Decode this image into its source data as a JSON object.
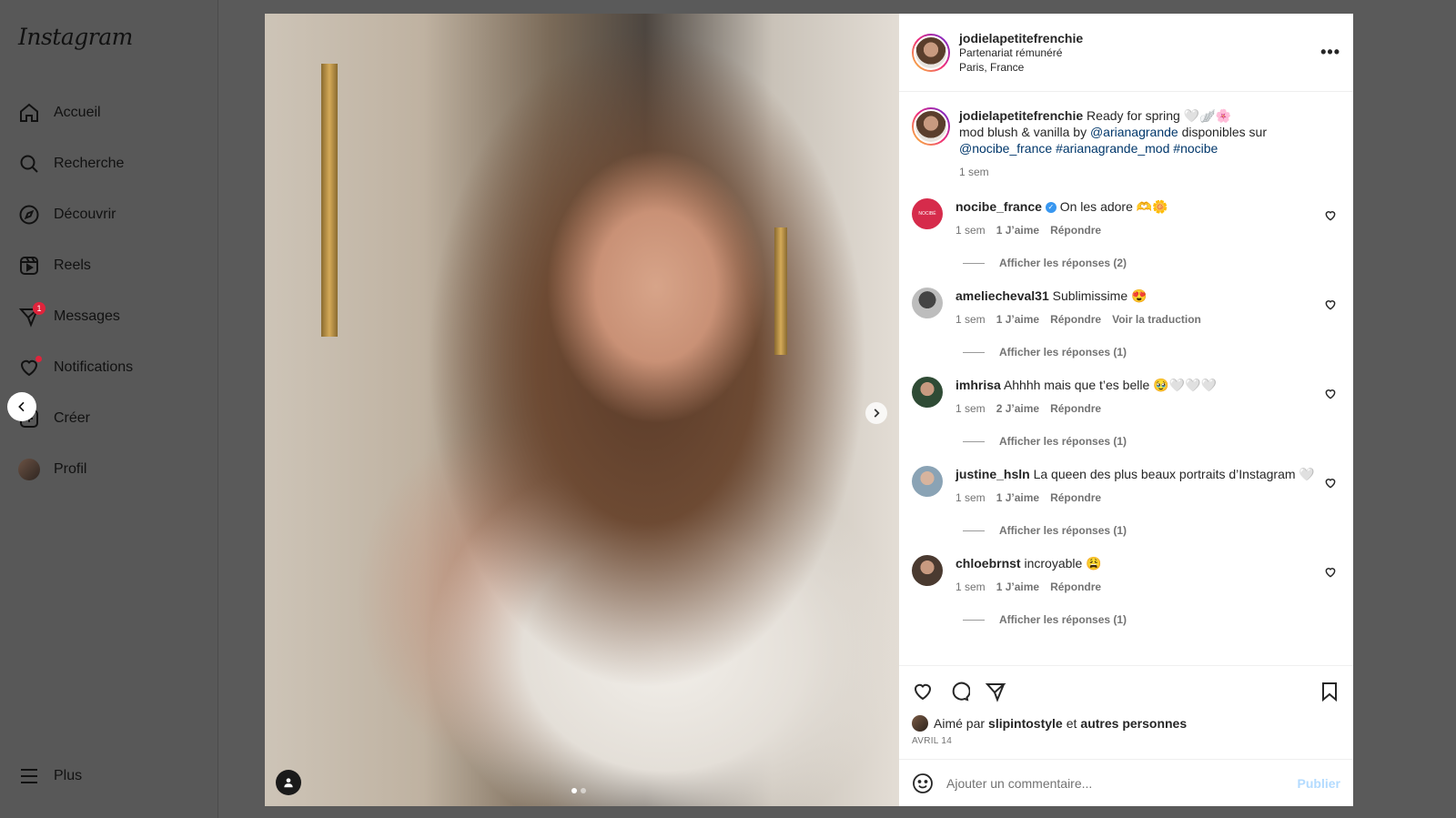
{
  "app": {
    "logo": "Instagram"
  },
  "sidebar": {
    "items": [
      {
        "label": "Accueil",
        "icon": "home-icon"
      },
      {
        "label": "Recherche",
        "icon": "search-icon"
      },
      {
        "label": "Découvrir",
        "icon": "compass-icon"
      },
      {
        "label": "Reels",
        "icon": "reels-icon"
      },
      {
        "label": "Messages",
        "icon": "messenger-icon",
        "badge": "1"
      },
      {
        "label": "Notifications",
        "icon": "heart-icon"
      },
      {
        "label": "Créer",
        "icon": "plus-square-icon"
      },
      {
        "label": "Profil",
        "icon": "avatar"
      }
    ],
    "more_label": "Plus"
  },
  "post": {
    "author": "jodielapetitefrenchie",
    "paid_partnership": "Partenariat rémunéré",
    "location": "Paris, France",
    "caption": {
      "text1": "Ready for spring 🤍🪽🌸",
      "text2": "mod blush & vanilla by ",
      "mention1": "@arianagrande",
      "text3": " disponibles sur",
      "mention2": "@nocibe_france",
      "tag1": "#arianagrande_mod",
      "tag2": "#nocibe",
      "time": "1 sem"
    },
    "carousel": {
      "current": 1,
      "total": 2
    }
  },
  "comments": [
    {
      "user": "nocibe_france",
      "verified": true,
      "text": "On les adore 🫶🌼",
      "time": "1 sem",
      "likes": "1 J’aime",
      "reply": "Répondre",
      "translate": "",
      "replies": "Afficher les réponses (2)",
      "avatar_color": "#d62b4b",
      "avatar_text": "NOCIBÉ"
    },
    {
      "user": "ameliecheval31",
      "verified": false,
      "text": "Sublimissime 😍",
      "time": "1 sem",
      "likes": "1 J’aime",
      "reply": "Répondre",
      "translate": "Voir la traduction",
      "replies": "Afficher les réponses (1)",
      "avatar_color": "#6d6d6d"
    },
    {
      "user": "imhrisa",
      "verified": false,
      "text": "Ahhhh mais que t’es belle 🥹🤍🤍🤍",
      "time": "1 sem",
      "likes": "2 J’aime",
      "reply": "Répondre",
      "translate": "",
      "replies": "Afficher les réponses (1)",
      "avatar_color": "#2f4b35"
    },
    {
      "user": "justine_hsln",
      "verified": false,
      "text": "La queen des plus beaux portraits d’Instagram 🤍",
      "time": "1 sem",
      "likes": "1 J’aime",
      "reply": "Répondre",
      "translate": "",
      "replies": "Afficher les réponses (1)",
      "avatar_color": "#8aa3b5"
    },
    {
      "user": "chloebrnst",
      "verified": false,
      "text": "incroyable 😩",
      "time": "1 sem",
      "likes": "1 J’aime",
      "reply": "Répondre",
      "translate": "",
      "replies": "Afficher les réponses (1)",
      "avatar_color": "#4a3a30"
    }
  ],
  "likes": {
    "prefix": "Aimé par ",
    "user": "slipintostyle",
    "middle": " et ",
    "others": "autres personnes"
  },
  "date": "AVRIL 14",
  "add_comment": {
    "placeholder": "Ajouter un commentaire...",
    "publish": "Publier"
  },
  "colors": {
    "accent_link": "#00376b",
    "publish_disabled": "#b3dbff",
    "badge": "#e0243c",
    "verified": "#3897f0"
  }
}
